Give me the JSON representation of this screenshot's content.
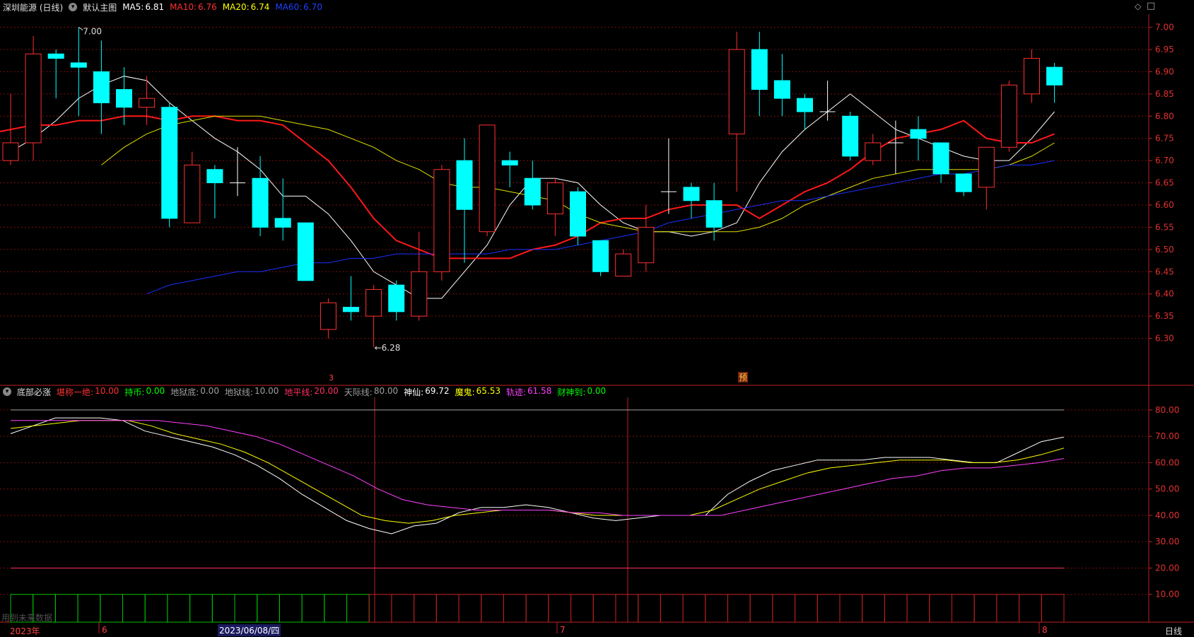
{
  "header": {
    "stock_name": "深圳能源 (日线)",
    "template": "默认主图",
    "ma": [
      {
        "label": "MA5:",
        "value": "6.81",
        "color": "#ffffff"
      },
      {
        "label": "MA10:",
        "value": "6.76",
        "color": "#ff3030"
      },
      {
        "label": "MA20:",
        "value": "6.74",
        "color": "#ffff00"
      },
      {
        "label": "MA60:",
        "value": "6.70",
        "color": "#2040ff"
      }
    ]
  },
  "indicator": {
    "name": "底部必涨",
    "items": [
      {
        "label": "堪称一绝:",
        "value": "10.00",
        "color": "#ff3030"
      },
      {
        "label": "持币:",
        "value": "0.00",
        "color": "#00ff00"
      },
      {
        "label": "地狱底:",
        "value": "0.00",
        "color": "#a0a0a0"
      },
      {
        "label": "地狱线:",
        "value": "10.00",
        "color": "#a0a0a0"
      },
      {
        "label": "地平线:",
        "value": "20.00",
        "color": "#ff3060"
      },
      {
        "label": "天际线:",
        "value": "80.00",
        "color": "#a0a0a0"
      },
      {
        "label": "神仙:",
        "value": "69.72",
        "color": "#ffffff"
      },
      {
        "label": "魔鬼:",
        "value": "65.53",
        "color": "#ffff00"
      },
      {
        "label": "轨迹:",
        "value": "61.58",
        "color": "#ff40ff"
      },
      {
        "label": "财神到:",
        "value": "0.00",
        "color": "#00ff00"
      }
    ]
  },
  "footer": {
    "year_label": "2023年",
    "date_label": "2023/06/08/四",
    "month_marks": [
      "6",
      "7",
      "8"
    ],
    "period_label": "日线",
    "watermark": "用到未来数据"
  },
  "markers": {
    "high": "7.00",
    "low": "6.28",
    "left_mark": "3",
    "right_mark": "预"
  },
  "colors": {
    "up": "#ff3030",
    "down": "#00ffff",
    "grid": "#7a1010",
    "axis": "#c02020"
  },
  "chart_data": [
    {
      "type": "candlestick",
      "ylim": [
        6.25,
        7.02
      ],
      "yticks": [
        "7.00",
        "6.95",
        "6.90",
        "6.85",
        "6.80",
        "6.75",
        "6.70",
        "6.65",
        "6.60",
        "6.55",
        "6.50",
        "6.45",
        "6.40",
        "6.35",
        "6.30"
      ],
      "candles": [
        {
          "o": 6.7,
          "c": 6.74,
          "h": 6.85,
          "l": 6.69
        },
        {
          "o": 6.74,
          "c": 6.94,
          "h": 6.98,
          "l": 6.7
        },
        {
          "o": 6.94,
          "c": 6.93,
          "h": 6.95,
          "l": 6.84
        },
        {
          "o": 6.92,
          "c": 6.91,
          "h": 7.0,
          "l": 6.8
        },
        {
          "o": 6.9,
          "c": 6.83,
          "h": 6.97,
          "l": 6.76
        },
        {
          "o": 6.86,
          "c": 6.82,
          "h": 6.91,
          "l": 6.78
        },
        {
          "o": 6.82,
          "c": 6.84,
          "h": 6.89,
          "l": 6.78
        },
        {
          "o": 6.82,
          "c": 6.57,
          "h": 6.83,
          "l": 6.55
        },
        {
          "o": 6.56,
          "c": 6.69,
          "h": 6.72,
          "l": 6.56
        },
        {
          "o": 6.68,
          "c": 6.65,
          "h": 6.69,
          "l": 6.57
        },
        {
          "o": 6.65,
          "c": 6.65,
          "h": 6.73,
          "l": 6.62
        },
        {
          "o": 6.66,
          "c": 6.55,
          "h": 6.71,
          "l": 6.53
        },
        {
          "o": 6.57,
          "c": 6.55,
          "h": 6.66,
          "l": 6.52
        },
        {
          "o": 6.56,
          "c": 6.43,
          "h": 6.56,
          "l": 6.43
        },
        {
          "o": 6.32,
          "c": 6.38,
          "h": 6.39,
          "l": 6.3
        },
        {
          "o": 6.37,
          "c": 6.36,
          "h": 6.44,
          "l": 6.34
        },
        {
          "o": 6.35,
          "c": 6.41,
          "h": 6.42,
          "l": 6.28
        },
        {
          "o": 6.42,
          "c": 6.36,
          "h": 6.43,
          "l": 6.34
        },
        {
          "o": 6.35,
          "c": 6.45,
          "h": 6.54,
          "l": 6.34
        },
        {
          "o": 6.45,
          "c": 6.68,
          "h": 6.69,
          "l": 6.43
        },
        {
          "o": 6.7,
          "c": 6.59,
          "h": 6.75,
          "l": 6.47
        },
        {
          "o": 6.54,
          "c": 6.78,
          "h": 6.78,
          "l": 6.53
        },
        {
          "o": 6.7,
          "c": 6.69,
          "h": 6.72,
          "l": 6.64
        },
        {
          "o": 6.66,
          "c": 6.6,
          "h": 6.7,
          "l": 6.59
        },
        {
          "o": 6.58,
          "c": 6.65,
          "h": 6.66,
          "l": 6.53
        },
        {
          "o": 6.63,
          "c": 6.53,
          "h": 6.64,
          "l": 6.51
        },
        {
          "o": 6.52,
          "c": 6.45,
          "h": 6.52,
          "l": 6.44
        },
        {
          "o": 6.44,
          "c": 6.49,
          "h": 6.5,
          "l": 6.44
        },
        {
          "o": 6.47,
          "c": 6.55,
          "h": 6.6,
          "l": 6.45
        },
        {
          "o": 6.63,
          "c": 6.63,
          "h": 6.75,
          "l": 6.58
        },
        {
          "o": 6.64,
          "c": 6.61,
          "h": 6.65,
          "l": 6.57
        },
        {
          "o": 6.61,
          "c": 6.55,
          "h": 6.65,
          "l": 6.52
        },
        {
          "o": 6.76,
          "c": 6.95,
          "h": 6.99,
          "l": 6.63
        },
        {
          "o": 6.95,
          "c": 6.86,
          "h": 6.99,
          "l": 6.8
        },
        {
          "o": 6.88,
          "c": 6.84,
          "h": 6.94,
          "l": 6.8
        },
        {
          "o": 6.84,
          "c": 6.81,
          "h": 6.85,
          "l": 6.77
        },
        {
          "o": 6.81,
          "c": 6.81,
          "h": 6.88,
          "l": 6.79
        },
        {
          "o": 6.8,
          "c": 6.71,
          "h": 6.81,
          "l": 6.7
        },
        {
          "o": 6.7,
          "c": 6.74,
          "h": 6.76,
          "l": 6.69
        },
        {
          "o": 6.74,
          "c": 6.74,
          "h": 6.79,
          "l": 6.67
        },
        {
          "o": 6.77,
          "c": 6.75,
          "h": 6.8,
          "l": 6.7
        },
        {
          "o": 6.74,
          "c": 6.67,
          "h": 6.74,
          "l": 6.65
        },
        {
          "o": 6.67,
          "c": 6.63,
          "h": 6.67,
          "l": 6.62
        },
        {
          "o": 6.64,
          "c": 6.73,
          "h": 6.73,
          "l": 6.59
        },
        {
          "o": 6.73,
          "c": 6.87,
          "h": 6.88,
          "l": 6.72
        },
        {
          "o": 6.85,
          "c": 6.93,
          "h": 6.95,
          "l": 6.83
        },
        {
          "o": 6.91,
          "c": 6.87,
          "h": 6.92,
          "l": 6.83
        }
      ],
      "series": [
        {
          "name": "MA5",
          "color": "#ffffff",
          "width": 1,
          "values": [
            6.72,
            6.75,
            6.79,
            6.84,
            6.87,
            6.89,
            6.88,
            6.83,
            6.79,
            6.75,
            6.72,
            6.68,
            6.62,
            6.62,
            6.58,
            6.52,
            6.45,
            6.42,
            6.39,
            6.39,
            6.45,
            6.51,
            6.6,
            6.66,
            6.66,
            6.65,
            6.6,
            6.56,
            6.54,
            6.54,
            6.53,
            6.54,
            6.56,
            6.65,
            6.72,
            6.77,
            6.81,
            6.85,
            6.81,
            6.77,
            6.75,
            6.73,
            6.71,
            6.7,
            6.7,
            6.75,
            6.81
          ]
        },
        {
          "name": "MA10",
          "color": "#ff1818",
          "width": 2,
          "values": [
            6.76,
            6.77,
            6.78,
            6.78,
            6.79,
            6.79,
            6.8,
            6.8,
            6.79,
            6.8,
            6.8,
            6.79,
            6.79,
            6.78,
            6.74,
            6.7,
            6.64,
            6.57,
            6.52,
            6.5,
            6.48,
            6.48,
            6.48,
            6.48,
            6.5,
            6.51,
            6.53,
            6.56,
            6.57,
            6.57,
            6.59,
            6.6,
            6.6,
            6.6,
            6.57,
            6.6,
            6.63,
            6.65,
            6.68,
            6.72,
            6.75,
            6.76,
            6.77,
            6.79,
            6.75,
            6.74,
            6.74,
            6.76
          ]
        },
        {
          "name": "MA20",
          "color": "#e0e000",
          "width": 1,
          "values": [
            6.69,
            6.73,
            6.76,
            6.78,
            6.79,
            6.8,
            6.8,
            6.8,
            6.79,
            6.78,
            6.77,
            6.75,
            6.73,
            6.7,
            6.68,
            6.65,
            6.64,
            6.64,
            6.63,
            6.62,
            6.61,
            6.58,
            6.56,
            6.55,
            6.54,
            6.54,
            6.54,
            6.54,
            6.54,
            6.55,
            6.57,
            6.6,
            6.62,
            6.64,
            6.66,
            6.67,
            6.68,
            6.68,
            6.68,
            6.68,
            6.69,
            6.71,
            6.74
          ]
        },
        {
          "name": "MA60",
          "color": "#1a30ff",
          "width": 1,
          "values": [
            6.4,
            6.42,
            6.43,
            6.44,
            6.45,
            6.45,
            6.46,
            6.47,
            6.47,
            6.48,
            6.48,
            6.49,
            6.49,
            6.49,
            6.49,
            6.49,
            6.5,
            6.5,
            6.5,
            6.51,
            6.52,
            6.53,
            6.54,
            6.56,
            6.57,
            6.58,
            6.59,
            6.6,
            6.61,
            6.61,
            6.62,
            6.63,
            6.64,
            6.65,
            6.66,
            6.67,
            6.67,
            6.68,
            6.69,
            6.69,
            6.7
          ]
        }
      ]
    },
    {
      "type": "line",
      "ylim": [
        0,
        84
      ],
      "yticks": [
        "80.00",
        "70.00",
        "60.00",
        "50.00",
        "40.00",
        "30.00",
        "20.00",
        "10.00"
      ],
      "hlines": [
        {
          "value": 80,
          "color": "#a0a0a0"
        },
        {
          "value": 20,
          "color": "#ff3060"
        }
      ],
      "series": [
        {
          "name": "神仙",
          "color": "#ffffff",
          "values": [
            71,
            74,
            77,
            77,
            77,
            76,
            72,
            70,
            68,
            66,
            63,
            59,
            54,
            48,
            43,
            38,
            35,
            33,
            36,
            37,
            41,
            43,
            43,
            44,
            43,
            41,
            39,
            38,
            39,
            40,
            40,
            40,
            48,
            53,
            57,
            59,
            61,
            61,
            61,
            62,
            62,
            62,
            61,
            60,
            60,
            64,
            68,
            69.72
          ]
        },
        {
          "name": "魔鬼",
          "color": "#ffff00",
          "values": [
            73,
            74,
            75,
            76,
            76,
            76,
            74,
            71,
            69,
            67,
            64,
            60,
            55,
            50,
            45,
            40,
            38,
            37,
            38,
            40,
            41,
            42,
            42,
            42,
            41,
            40,
            40,
            40,
            40,
            40,
            42,
            46,
            50,
            53,
            56,
            58,
            59,
            60,
            61,
            61,
            61,
            60,
            60,
            61,
            63,
            65.53
          ]
        },
        {
          "name": "轨迹",
          "color": "#ff40ff",
          "values": [
            76,
            76,
            76,
            76,
            76,
            76,
            76,
            75,
            74,
            72,
            70,
            67,
            63,
            59,
            55,
            50,
            46,
            44,
            43,
            42,
            42,
            42,
            42,
            41,
            41,
            40,
            40,
            40,
            40,
            40,
            42,
            44,
            46,
            48,
            50,
            52,
            54,
            55,
            57,
            58,
            58,
            59,
            60,
            61.58
          ]
        }
      ],
      "bars": {
        "green_count": 16,
        "red_count": 31,
        "value": 10
      }
    }
  ]
}
